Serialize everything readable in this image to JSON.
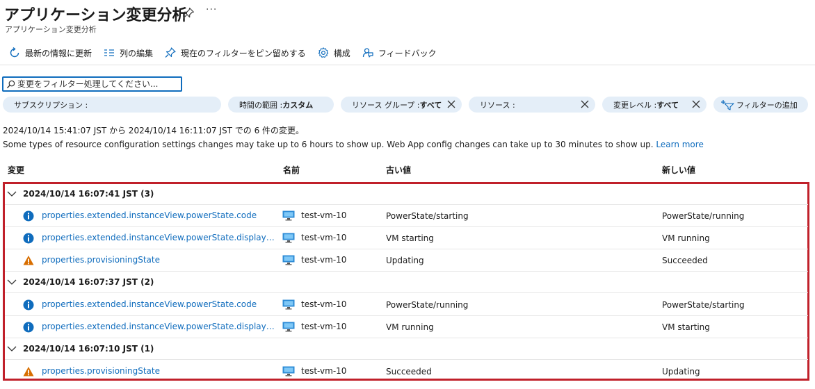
{
  "header": {
    "title": "アプリケーション変更分析",
    "subtitle": "アプリケーション変更分析",
    "more": "···"
  },
  "toolbar": {
    "refresh": "最新の情報に更新",
    "edit_columns": "列の編集",
    "pin_filter": "現在のフィルターをピン留めする",
    "configure": "構成",
    "feedback": "フィードバック"
  },
  "search": {
    "value": "",
    "placeholder": "変更をフィルター処理してください..."
  },
  "filters": {
    "subscription": {
      "label": "サブスクリプション :",
      "value": ""
    },
    "time_range": {
      "label": "時間の範囲 : ",
      "value": "カスタム"
    },
    "resource_group": {
      "label": "リソース グループ : ",
      "value": "すべて"
    },
    "resource": {
      "label": "リソース : ",
      "value": ""
    },
    "change_level": {
      "label": "変更レベル : ",
      "value": "すべて"
    },
    "add_filter": "フィルターの追加"
  },
  "summary": {
    "range_text": "2024/10/14 15:41:07 JST から 2024/10/14 16:11:07 JST での 6 件の変更。",
    "note": "Some types of resource configuration settings changes may take up to 6 hours to show up. Web App config changes can take up to 30 minutes to show up.",
    "learn_more": "Learn more"
  },
  "columns": {
    "change": "変更",
    "name": "名前",
    "old_value": "古い値",
    "new_value": "新しい値"
  },
  "groups": [
    {
      "label": "2024/10/14 16:07:41 JST (3)",
      "rows": [
        {
          "severity": "info",
          "change": "properties.extended.instanceView.powerState.code",
          "name": "test-vm-10",
          "old": "PowerState/starting",
          "new": "PowerState/running"
        },
        {
          "severity": "info",
          "change": "properties.extended.instanceView.powerState.displayStatus",
          "name": "test-vm-10",
          "old": "VM starting",
          "new": "VM running"
        },
        {
          "severity": "warning",
          "change": "properties.provisioningState",
          "name": "test-vm-10",
          "old": "Updating",
          "new": "Succeeded"
        }
      ]
    },
    {
      "label": "2024/10/14 16:07:37 JST (2)",
      "rows": [
        {
          "severity": "info",
          "change": "properties.extended.instanceView.powerState.code",
          "name": "test-vm-10",
          "old": "PowerState/running",
          "new": "PowerState/starting"
        },
        {
          "severity": "info",
          "change": "properties.extended.instanceView.powerState.displayStatus",
          "name": "test-vm-10",
          "old": "VM running",
          "new": "VM starting"
        }
      ]
    },
    {
      "label": "2024/10/14 16:07:10 JST (1)",
      "rows": [
        {
          "severity": "warning",
          "change": "properties.provisioningState",
          "name": "test-vm-10",
          "old": "Succeeded",
          "new": "Updating"
        }
      ]
    }
  ],
  "colors": {
    "accent": "#0f6cbd",
    "highlight_border": "#c0202a",
    "pill_bg": "#e4eef8",
    "warning": "#d86e00",
    "info": "#0f6cbd"
  },
  "icons": {
    "pin": "pin-icon",
    "refresh": "refresh-icon",
    "columns": "columns-icon",
    "gear": "gear-icon",
    "feedback": "feedback-icon",
    "info": "info-icon",
    "warning": "warning-icon",
    "vm": "vm-icon"
  }
}
